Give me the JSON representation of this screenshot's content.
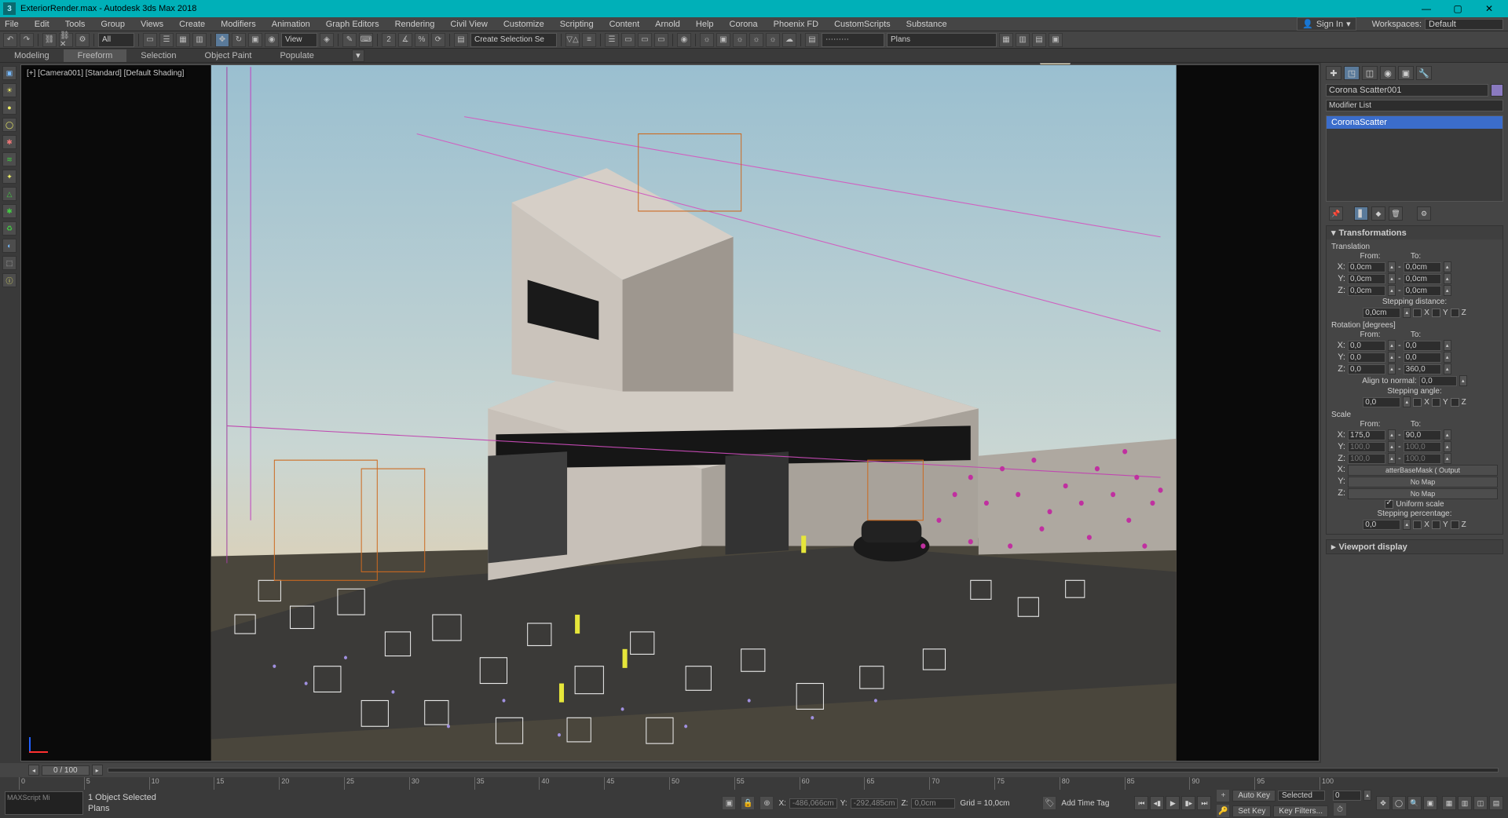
{
  "title": "ExteriorRender.max - Autodesk 3ds Max 2018",
  "app_icon": "3",
  "menus": [
    "File",
    "Edit",
    "Tools",
    "Group",
    "Views",
    "Create",
    "Modifiers",
    "Animation",
    "Graph Editors",
    "Rendering",
    "Civil View",
    "Customize",
    "Scripting",
    "Content",
    "Arnold",
    "Help",
    "Corona",
    "Phoenix FD",
    "CustomScripts",
    "Substance"
  ],
  "signin": "Sign In",
  "workspaces_label": "Workspaces:",
  "workspaces_value": "Default",
  "toolbar": {
    "filter_sel": "All",
    "view_sel": "View",
    "create_sel": "Create Selection Se",
    "plans_sel": "Plans"
  },
  "ribbon_tabs": [
    "Modeling",
    "Freeform",
    "Selection",
    "Object Paint",
    "Populate"
  ],
  "ribbon_active": 1,
  "tooltip": "Plans",
  "viewport_label": "[+] [Camera001] [Standard] [Default Shading]",
  "cmd": {
    "object_name": "Corona Scatter001",
    "modifier_list": "Modifier List",
    "stack_item": "CoronaScatter",
    "rollout_title": "Transformations",
    "translation_label": "Translation",
    "from": "From:",
    "to": "To:",
    "trans_x_from": "0,0cm",
    "trans_x_to": "0,0cm",
    "trans_y_from": "0,0cm",
    "trans_y_to": "0,0cm",
    "trans_z_from": "0,0cm",
    "trans_z_to": "0,0cm",
    "step_dist": "Stepping distance:",
    "step_dist_val": "0,0cm",
    "rot_label": "Rotation [degrees]",
    "rot_x_from": "0,0",
    "rot_x_to": "0,0",
    "rot_y_from": "0,0",
    "rot_y_to": "0,0",
    "rot_z_from": "0,0",
    "rot_z_to": "360,0",
    "align_normal": "Align to normal:",
    "align_normal_val": "0,0",
    "step_angle": "Stepping angle:",
    "step_angle_val": "0,0",
    "scale_label": "Scale",
    "scale_x_from": "175,0",
    "scale_x_to": "90,0",
    "scale_y_from": "100,0",
    "scale_y_to": "100,0",
    "scale_z_from": "100,0",
    "scale_z_to": "100,0",
    "map_x": "atterBaseMask  ( Output",
    "map_y": "No Map",
    "map_z": "No Map",
    "uniform": "Uniform scale",
    "step_pct": "Stepping percentage:",
    "step_pct_val": "0,0",
    "next_rollout": "Viewport display",
    "x": "X",
    "y": "Y",
    "z": "Z",
    "x2": "X:",
    "y2": "Y:",
    "z2": "Z:"
  },
  "time": {
    "thumb": "0 / 100",
    "ticks": [
      "0",
      "5",
      "10",
      "15",
      "20",
      "25",
      "30",
      "35",
      "40",
      "45",
      "50",
      "55",
      "60",
      "65",
      "70",
      "75",
      "80",
      "85",
      "90",
      "95",
      "100"
    ]
  },
  "status": {
    "maxscript": "MAXScript Mi",
    "selected": "1 Object Selected",
    "layer": "Plans",
    "x_label": "X:",
    "x_val": "-486,066cm",
    "y_label": "Y:",
    "y_val": "-292,485cm",
    "z_label": "Z:",
    "z_val": "0,0cm",
    "grid": "Grid = 10,0cm",
    "add_time_tag": "Add Time Tag",
    "autokey": "Auto Key",
    "selected2": "Selected",
    "setkey": "Set Key",
    "keyfilters": "Key Filters...",
    "frame": "0"
  }
}
